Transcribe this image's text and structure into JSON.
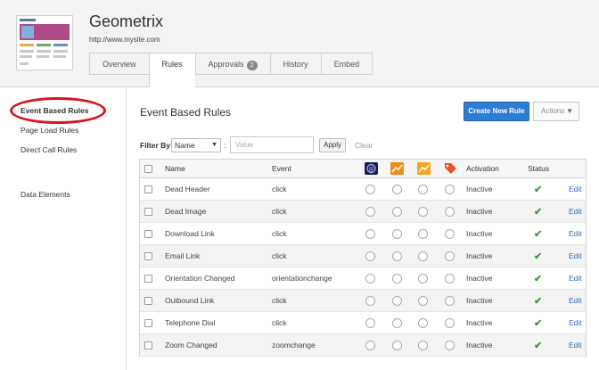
{
  "app": {
    "title": "Geometrix",
    "url": "http://www.mysite.com"
  },
  "tabs": [
    {
      "label": "Overview",
      "active": false
    },
    {
      "label": "Rules",
      "active": true
    },
    {
      "label": "Approvals",
      "active": false,
      "badge": "2"
    },
    {
      "label": "History",
      "active": false
    },
    {
      "label": "Embed",
      "active": false
    }
  ],
  "sidebar": {
    "items": [
      {
        "label": "Event Based Rules",
        "active": true
      },
      {
        "label": "Page Load Rules"
      },
      {
        "label": "Direct Call Rules"
      },
      {
        "label": "Data Elements"
      }
    ]
  },
  "main": {
    "title": "Event Based Rules",
    "create_label": "Create New Rule",
    "actions_label": "Actions"
  },
  "filter": {
    "label": "Filter By",
    "field": "Name",
    "colon": ":",
    "placeholder": "Value",
    "apply_label": "Apply",
    "clear_label": "Clear"
  },
  "table": {
    "headers": {
      "name": "Name",
      "event": "Event",
      "tool_icons": [
        "adobe-analytics-icon",
        "orange-chart-icon",
        "orange-chart-icon-2",
        "tag-icon"
      ],
      "activation": "Activation",
      "status": "Status"
    },
    "rows": [
      {
        "name": "Dead Header",
        "event": "click",
        "activation": "Inactive",
        "action": "Edit"
      },
      {
        "name": "Dead Image",
        "event": "click",
        "activation": "Inactive",
        "action": "Edit"
      },
      {
        "name": "Download Link",
        "event": "click",
        "activation": "Inactive",
        "action": "Edit"
      },
      {
        "name": "Email Link",
        "event": "click",
        "activation": "Inactive",
        "action": "Edit"
      },
      {
        "name": "Orientation Changed",
        "event": "orientationchange",
        "activation": "Inactive",
        "action": "Edit"
      },
      {
        "name": "Outbound Link",
        "event": "click",
        "activation": "Inactive",
        "action": "Edit"
      },
      {
        "name": "Telephone Dial",
        "event": "click",
        "activation": "Inactive",
        "action": "Edit"
      },
      {
        "name": "Zoom Changed",
        "event": "zoomchange",
        "activation": "Inactive",
        "action": "Edit"
      }
    ]
  },
  "colors": {
    "accent": "#2d7dd2",
    "highlight": "#d8141e",
    "status_ok": "#3e9a3a",
    "link": "#2a6ebb"
  }
}
